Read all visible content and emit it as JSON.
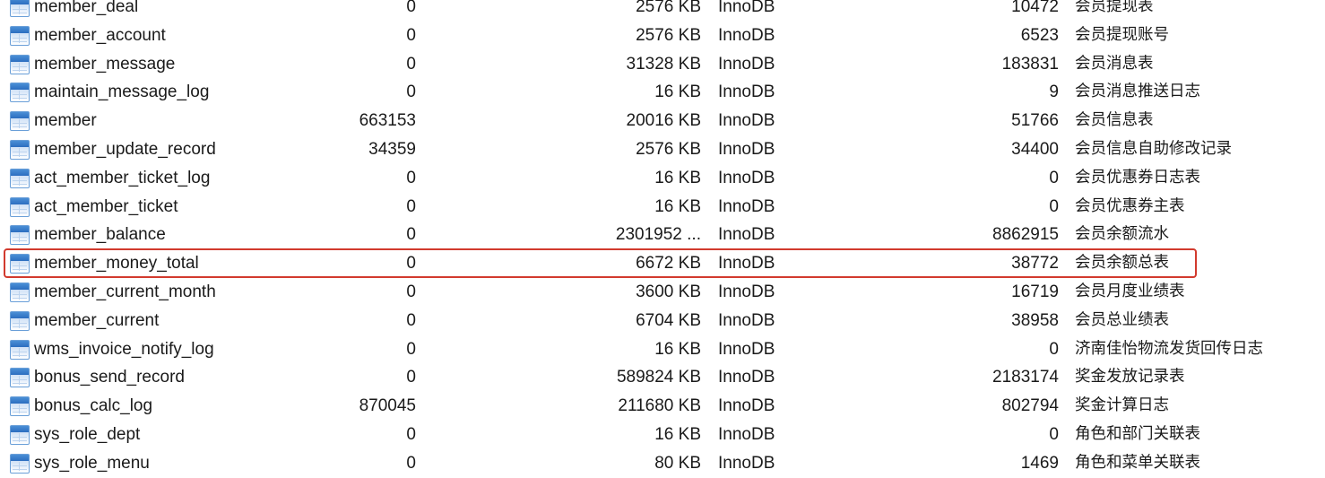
{
  "highlight_color": "#d23a2e",
  "table_icon": "table-icon",
  "tables": [
    {
      "name": "member_deal",
      "rows": "0",
      "data_length": "2576 KB",
      "engine": "InnoDB",
      "auto_increment": "10472",
      "comment": "会员提现表"
    },
    {
      "name": "member_account",
      "rows": "0",
      "data_length": "2576 KB",
      "engine": "InnoDB",
      "auto_increment": "6523",
      "comment": "会员提现账号"
    },
    {
      "name": "member_message",
      "rows": "0",
      "data_length": "31328 KB",
      "engine": "InnoDB",
      "auto_increment": "183831",
      "comment": "会员消息表"
    },
    {
      "name": "maintain_message_log",
      "rows": "0",
      "data_length": "16 KB",
      "engine": "InnoDB",
      "auto_increment": "9",
      "comment": "会员消息推送日志"
    },
    {
      "name": "member",
      "rows": "663153",
      "data_length": "20016 KB",
      "engine": "InnoDB",
      "auto_increment": "51766",
      "comment": "会员信息表"
    },
    {
      "name": "member_update_record",
      "rows": "34359",
      "data_length": "2576 KB",
      "engine": "InnoDB",
      "auto_increment": "34400",
      "comment": "会员信息自助修改记录"
    },
    {
      "name": "act_member_ticket_log",
      "rows": "0",
      "data_length": "16 KB",
      "engine": "InnoDB",
      "auto_increment": "0",
      "comment": "会员优惠券日志表"
    },
    {
      "name": "act_member_ticket",
      "rows": "0",
      "data_length": "16 KB",
      "engine": "InnoDB",
      "auto_increment": "0",
      "comment": "会员优惠券主表"
    },
    {
      "name": "member_balance",
      "rows": "0",
      "data_length": "2301952 ...",
      "engine": "InnoDB",
      "auto_increment": "8862915",
      "comment": "会员余额流水"
    },
    {
      "name": "member_money_total",
      "rows": "0",
      "data_length": "6672 KB",
      "engine": "InnoDB",
      "auto_increment": "38772",
      "comment": "会员余额总表",
      "highlighted": true
    },
    {
      "name": "member_current_month",
      "rows": "0",
      "data_length": "3600 KB",
      "engine": "InnoDB",
      "auto_increment": "16719",
      "comment": "会员月度业绩表"
    },
    {
      "name": "member_current",
      "rows": "0",
      "data_length": "6704 KB",
      "engine": "InnoDB",
      "auto_increment": "38958",
      "comment": "会员总业绩表"
    },
    {
      "name": "wms_invoice_notify_log",
      "rows": "0",
      "data_length": "16 KB",
      "engine": "InnoDB",
      "auto_increment": "0",
      "comment": "济南佳怡物流发货回传日志"
    },
    {
      "name": "bonus_send_record",
      "rows": "0",
      "data_length": "589824 KB",
      "engine": "InnoDB",
      "auto_increment": "2183174",
      "comment": "奖金发放记录表"
    },
    {
      "name": "bonus_calc_log",
      "rows": "870045",
      "data_length": "211680 KB",
      "engine": "InnoDB",
      "auto_increment": "802794",
      "comment": "奖金计算日志"
    },
    {
      "name": "sys_role_dept",
      "rows": "0",
      "data_length": "16 KB",
      "engine": "InnoDB",
      "auto_increment": "0",
      "comment": "角色和部门关联表"
    },
    {
      "name": "sys_role_menu",
      "rows": "0",
      "data_length": "80 KB",
      "engine": "InnoDB",
      "auto_increment": "1469",
      "comment": "角色和菜单关联表"
    }
  ]
}
